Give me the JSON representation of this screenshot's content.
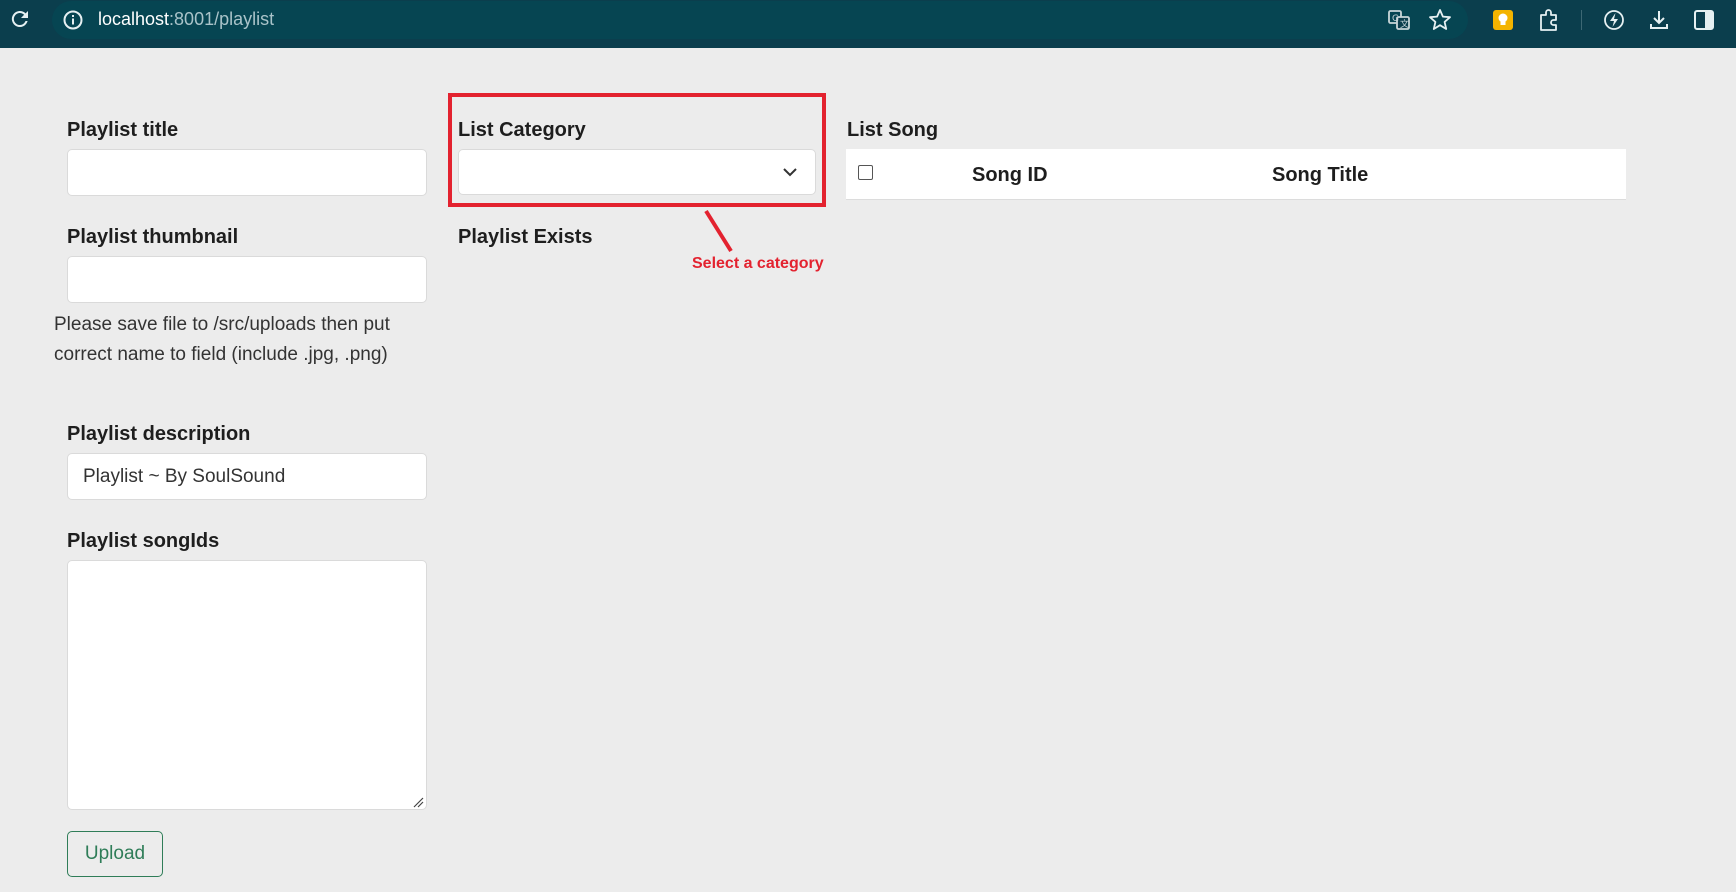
{
  "browser": {
    "url_host": "localhost",
    "url_rest": ":8001/playlist"
  },
  "form": {
    "title_label": "Playlist title",
    "title_value": "",
    "thumbnail_label": "Playlist thumbnail",
    "thumbnail_value": "",
    "thumbnail_help": "Please save file to /src/uploads then put correct name to field (include .jpg, .png)",
    "description_label": "Playlist description",
    "description_value": "Playlist ~ By SoulSound",
    "songids_label": "Playlist songIds",
    "songids_value": "",
    "upload_label": "Upload"
  },
  "category": {
    "label": "List Category",
    "selected": "",
    "exists_label": "Playlist Exists"
  },
  "annotation": {
    "callout_text": "Select a category",
    "color": "#e3222f"
  },
  "song_list": {
    "label": "List Song",
    "columns": [
      "Song ID",
      "Song Title"
    ]
  },
  "colors": {
    "topbar": "#0b3e4d",
    "background": "#ececec",
    "upload_accent": "#2f7d58"
  }
}
